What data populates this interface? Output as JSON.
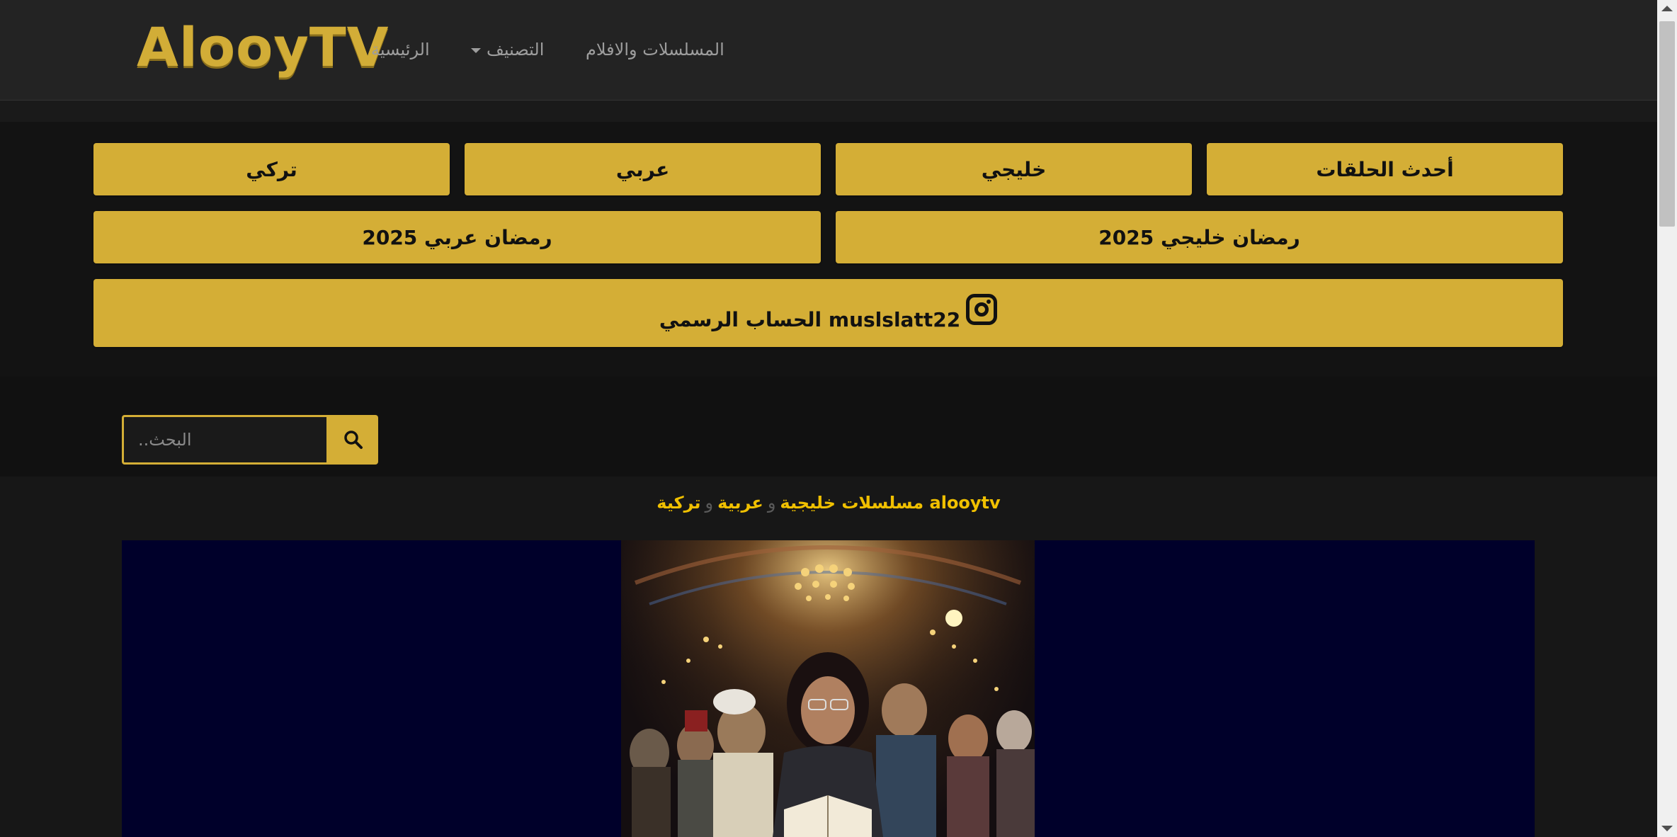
{
  "navbar": {
    "logo": "AlooyTV",
    "links": {
      "home": "الرئيسية",
      "category": "التصنيف",
      "series_movies": "المسلسلات والافلام"
    }
  },
  "category_buttons": {
    "latest_episodes": "أحدث الحلقات",
    "gulf": "خليجي",
    "arabic": "عربي",
    "turkish": "تركي",
    "ramadan_gulf": "رمضان خليجي 2025",
    "ramadan_arabic": "رمضان عربي 2025",
    "instagram": "muslslatt22 الحساب الرسمي"
  },
  "search": {
    "placeholder": "البحث.."
  },
  "tagline": {
    "part1": "alooytv مسلسلات خليجية",
    "sep1": "و",
    "part2": "عربية",
    "sep2": "و",
    "part3": "تركية"
  },
  "icons": {
    "search": "search-icon",
    "instagram": "instagram-icon",
    "caret": "caret-down-icon"
  },
  "colors": {
    "accent": "#d4ae36",
    "tagline": "#f0c000",
    "navbar_bg": "#232323",
    "page_bg": "#111111",
    "hero_bg": "#00002a"
  }
}
